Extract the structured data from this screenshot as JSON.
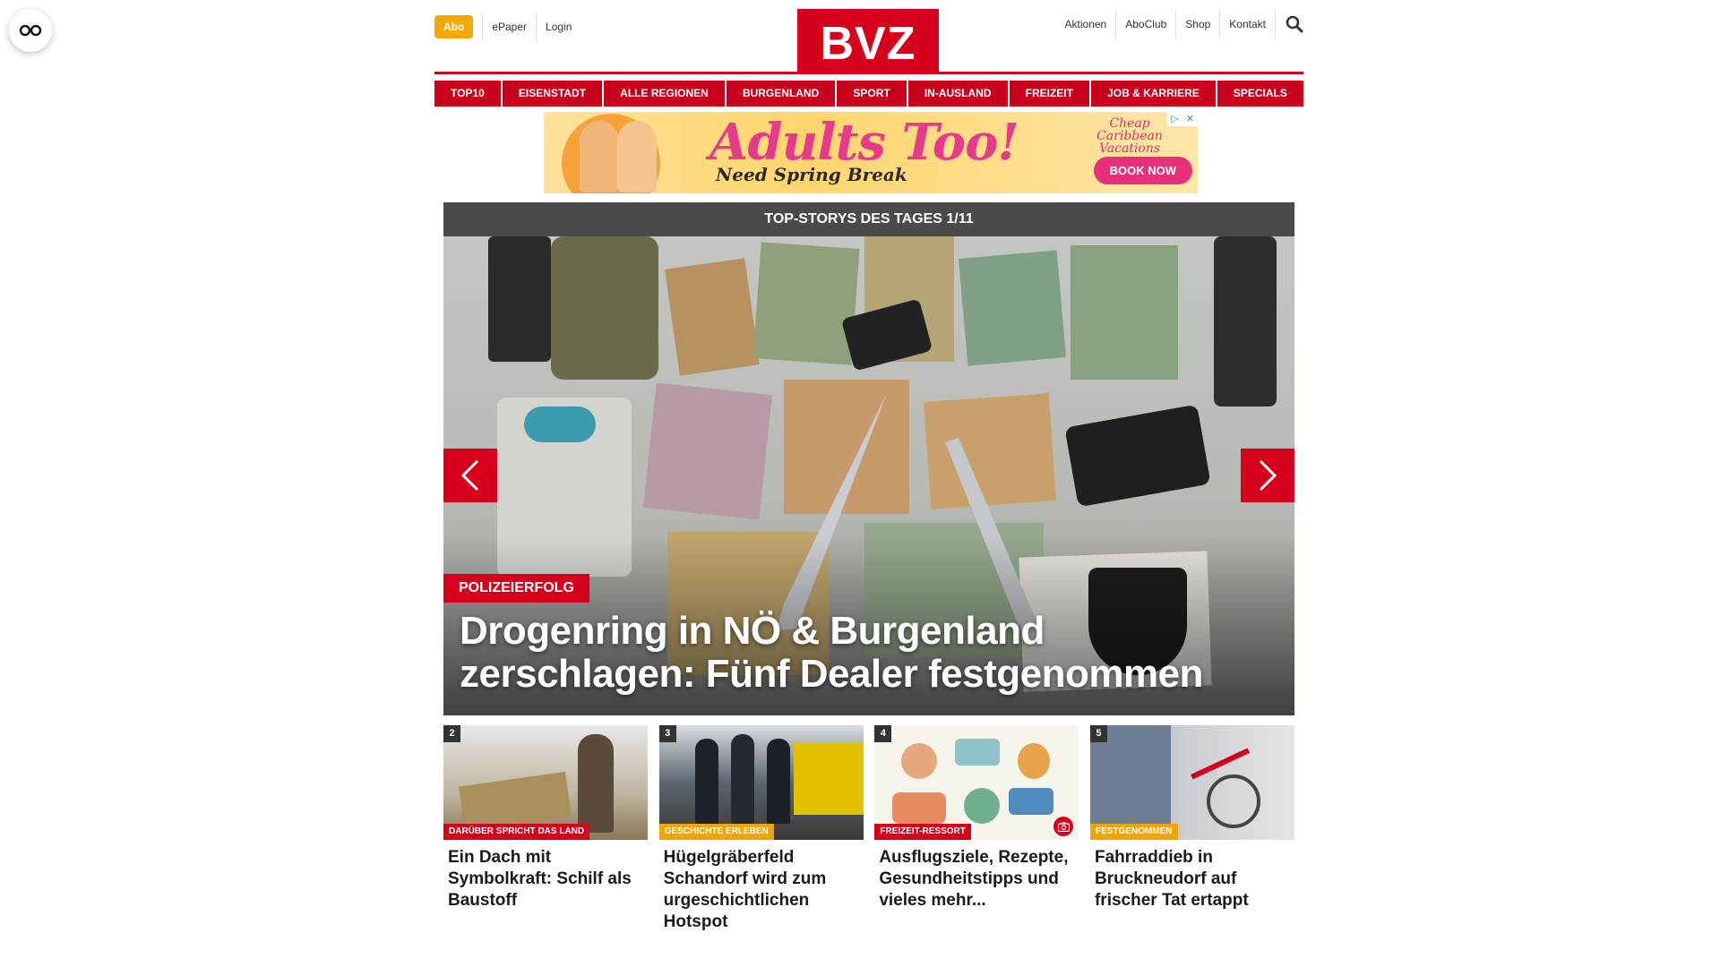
{
  "utility": {
    "reader_icon": "glasses-icon"
  },
  "header": {
    "abo_label": "Abo",
    "left_links": [
      "ePaper",
      "Login"
    ],
    "logo_text": "BVZ",
    "right_links": [
      "Aktionen",
      "AboClub",
      "Shop",
      "Kontakt"
    ],
    "search_icon": "search-icon"
  },
  "nav": [
    "TOP10",
    "EISENSTADT",
    "ALLE REGIONEN",
    "BURGENLAND",
    "SPORT",
    "IN-AUSLAND",
    "FREIZEIT",
    "JOB & KARRIERE",
    "SPECIALS"
  ],
  "ad": {
    "headline": "Adults Too!",
    "subline": "Need Spring Break",
    "brand": "Cheap Caribbean Vacations",
    "cta": "BOOK NOW",
    "adchoices_icon": "adchoices-icon",
    "close_icon": "close-icon"
  },
  "top_stories": {
    "heading": "TOP-STORYS DES TAGES 1/11",
    "hero": {
      "kicker": "POLIZEIERFOLG",
      "title": "Drogenring in NÖ & Burgenland zerschlagen: Fünf Dealer festgenommen"
    },
    "prev_icon": "chevron-left-icon",
    "next_icon": "chevron-right-icon"
  },
  "teasers": [
    {
      "num": "2",
      "tag": "DARÜBER SPRICHT DAS LAND",
      "tag_color": "#d6001c",
      "title": "Ein Dach mit Symbolkraft: Schilf als Baustoff"
    },
    {
      "num": "3",
      "tag": "GESCHICHTE ERLEBEN",
      "tag_color": "#f0a500",
      "title": "Hügelgräberfeld Schandorf wird zum urgeschichtlichen Hotspot"
    },
    {
      "num": "4",
      "tag": "FREIZEIT-RESSORT",
      "tag_color": "#d6001c",
      "title": "Ausflugsziele, Rezepte, Gesundheitstipps und vieles mehr...",
      "icon": "camera-icon"
    },
    {
      "num": "5",
      "tag": "FESTGENOMMEN",
      "tag_color": "#f0a500",
      "title": "Fahrraddieb in Bruckneudorf auf frischer Tat ertappt"
    }
  ],
  "colors": {
    "brand_red": "#d6001c",
    "abo_gold": "#f5a800",
    "dark_bar": "#4a4a4a"
  }
}
